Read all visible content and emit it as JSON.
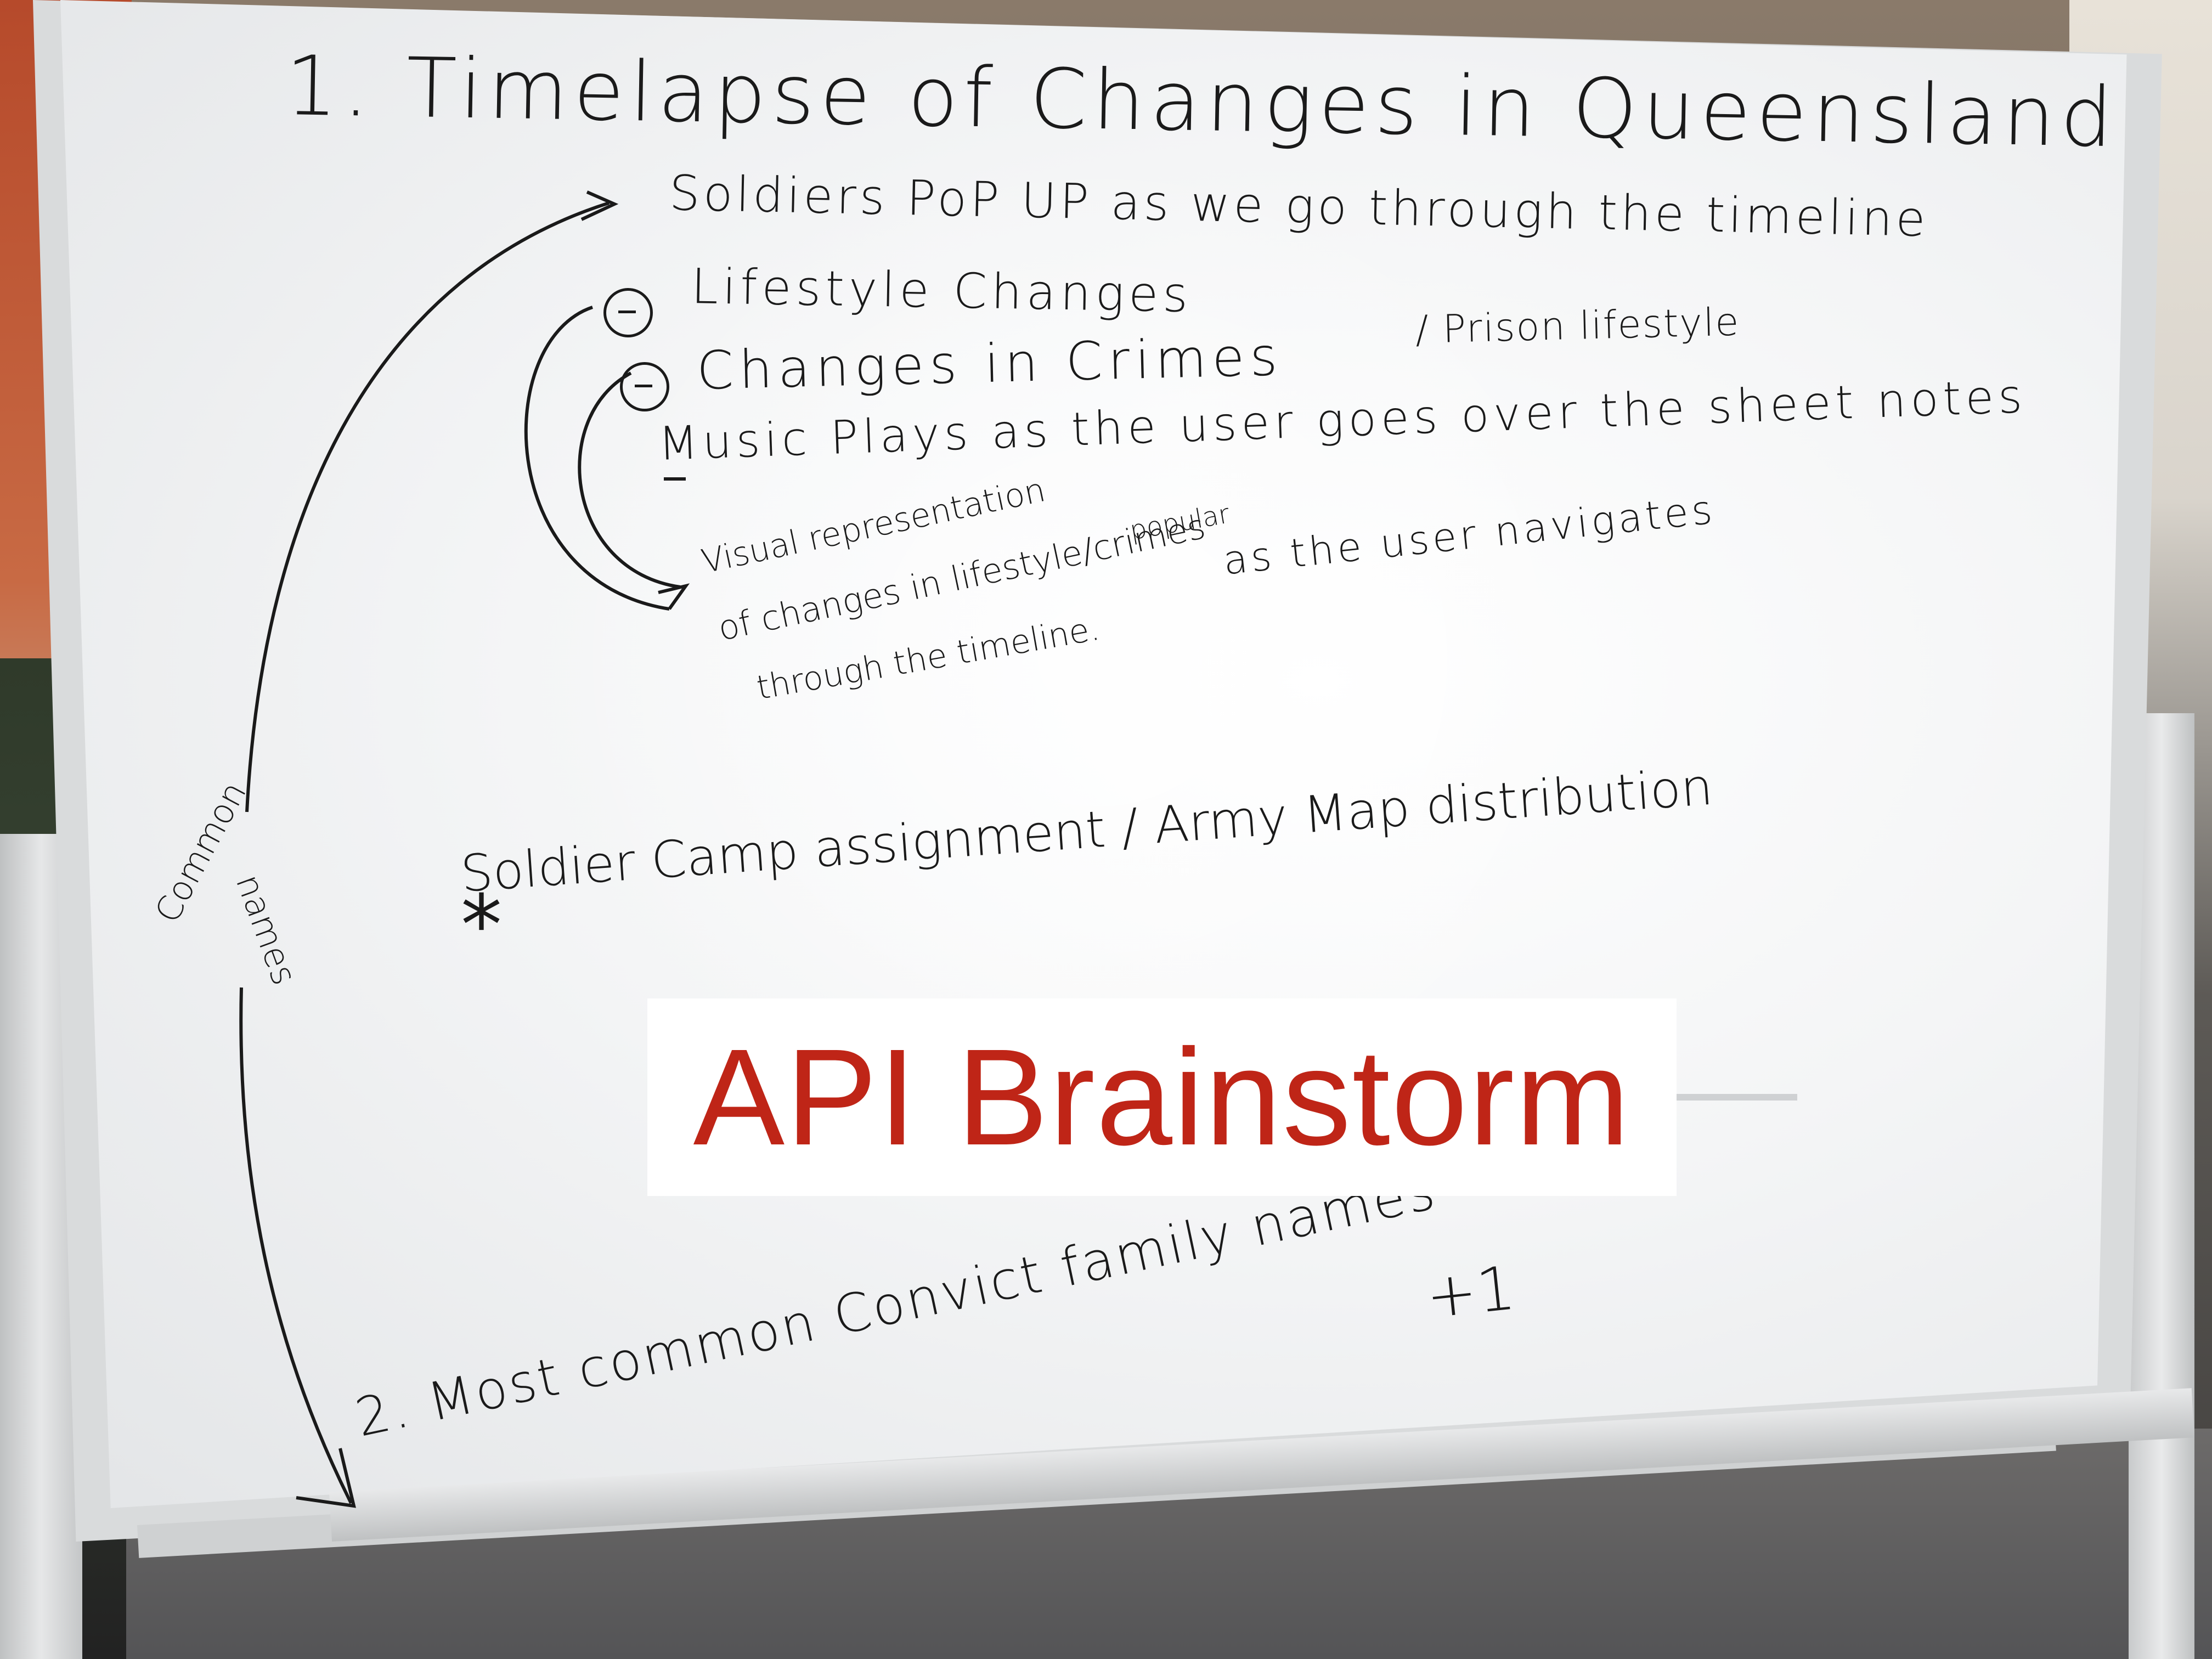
{
  "banner": {
    "title": "API Brainstorm"
  },
  "whiteboard": {
    "title": "1.  Timelapse  of Changes in  Queensland",
    "item_soldiers": "Soldiers PoP UP  as  we  go through the timeline",
    "item_lifestyle": "Lifestyle  Changes",
    "item_crimes": "Changes  in  Crimes",
    "item_prison": "/ Prison lifestyle",
    "item_music": "Music  Plays  as  the  user  goes over  the  sheet notes",
    "item_visual": "Visual representation",
    "item_popular": "popular",
    "item_lifestyle2": "of changes in lifestyle/crimes",
    "item_asuser": "as  the  user  navigates",
    "item_through": "through the timeline.",
    "item_soldiercamp": "Soldier Camp assignment / Army Map distribution",
    "side_common": "Common",
    "side_names": "names",
    "item_mostcommon": "2. Most  common  Convict  family  names",
    "item_plusone": "+1",
    "star": "*"
  }
}
